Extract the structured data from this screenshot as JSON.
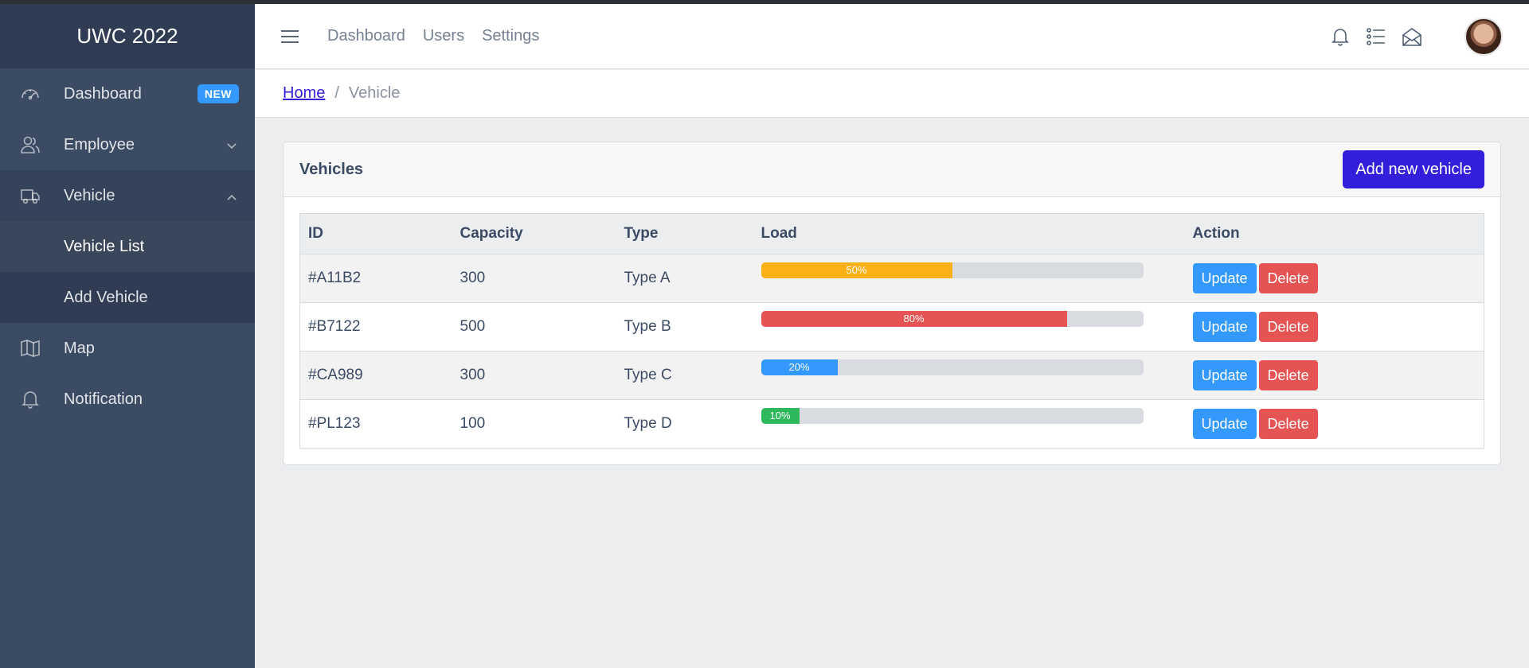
{
  "sidebar": {
    "brand": "UWC 2022",
    "items": [
      {
        "label": "Dashboard",
        "badge": "NEW",
        "icon": "speedometer-icon"
      },
      {
        "label": "Employee",
        "icon": "people-icon",
        "chevron": "chevron-down-icon"
      },
      {
        "label": "Vehicle",
        "icon": "truck-icon",
        "chevron": "chevron-up-icon"
      },
      {
        "label": "Map",
        "icon": "map-icon"
      },
      {
        "label": "Notification",
        "icon": "bell-icon"
      }
    ],
    "vehicle_sub": [
      {
        "label": "Vehicle List"
      },
      {
        "label": "Add Vehicle"
      }
    ]
  },
  "header": {
    "nav": [
      "Dashboard",
      "Users",
      "Settings"
    ],
    "icons": [
      "bell-icon",
      "list-icon",
      "envelope-open-icon"
    ]
  },
  "breadcrumb": {
    "home": "Home",
    "separator": "/",
    "current": "Vehicle"
  },
  "card": {
    "title": "Vehicles",
    "add_button": "Add new vehicle",
    "columns": [
      "ID",
      "Capacity",
      "Type",
      "Load",
      "Action"
    ],
    "rows": [
      {
        "id": "#A11B2",
        "capacity": "300",
        "type": "Type A",
        "load": 50,
        "load_label": "50%",
        "color": "#f9b115"
      },
      {
        "id": "#B7122",
        "capacity": "500",
        "type": "Type B",
        "load": 80,
        "load_label": "80%",
        "color": "#e55353"
      },
      {
        "id": "#CA989",
        "capacity": "300",
        "type": "Type C",
        "load": 20,
        "load_label": "20%",
        "color": "#3399ff"
      },
      {
        "id": "#PL123",
        "capacity": "100",
        "type": "Type D",
        "load": 10,
        "load_label": "10%",
        "color": "#2eb85c"
      }
    ],
    "update_label": "Update",
    "delete_label": "Delete"
  }
}
